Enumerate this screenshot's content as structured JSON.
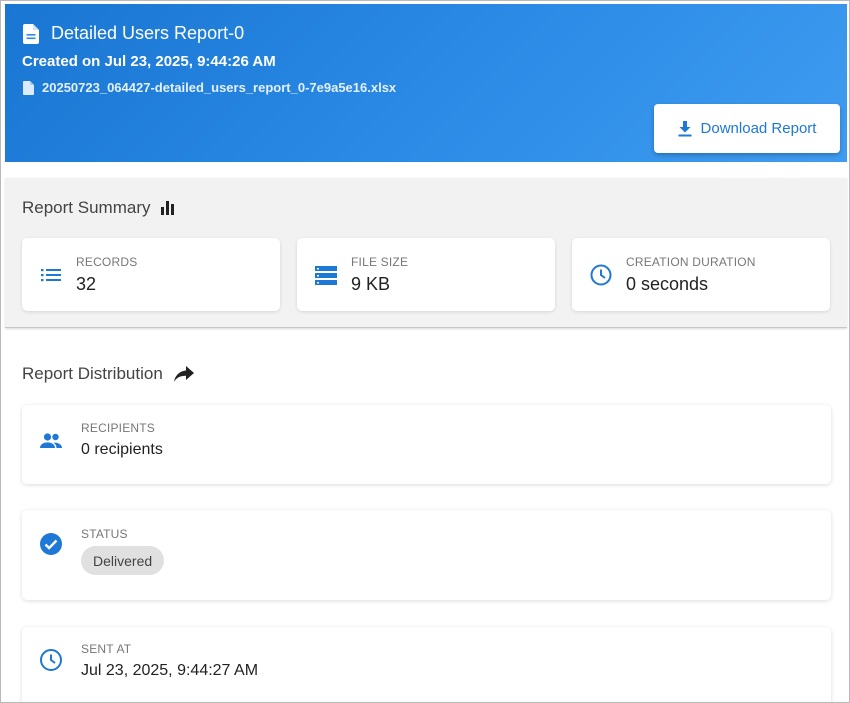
{
  "header": {
    "title": "Detailed Users Report-0",
    "created": "Created on Jul 23, 2025, 9:44:26 AM",
    "filename": "20250723_064427-detailed_users_report_0-7e9a5e16.xlsx",
    "download_label": "Download Report"
  },
  "summary": {
    "title": "Report Summary",
    "stats": [
      {
        "label": "RECORDS",
        "value": "32",
        "icon": "list-icon"
      },
      {
        "label": "FILE SIZE",
        "value": "9 KB",
        "icon": "storage-icon"
      },
      {
        "label": "CREATION DURATION",
        "value": "0 seconds",
        "icon": "clock-icon"
      }
    ]
  },
  "distribution": {
    "title": "Report Distribution",
    "recipients": {
      "label": "RECIPIENTS",
      "value": "0 recipients"
    },
    "status": {
      "label": "STATUS",
      "value": "Delivered"
    },
    "sent_at": {
      "label": "SENT AT",
      "value": "Jul 23, 2025, 9:44:27 AM"
    }
  },
  "colors": {
    "primary": "#1976d2",
    "accent": "#1e78d6",
    "summary_bg": "#f2f2f2",
    "badge_bg": "#e0e0e0"
  }
}
